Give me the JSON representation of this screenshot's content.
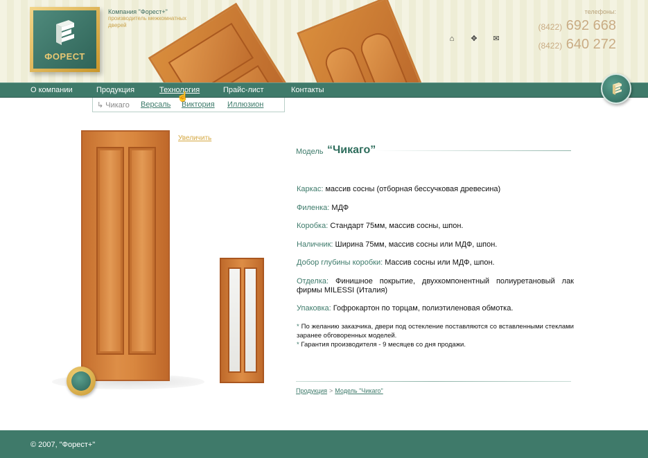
{
  "header": {
    "company_name": "Компания \"Форест+\"",
    "company_tagline": "производитель межкомнатных дверей",
    "logo_text": "ФОРЕСТ",
    "phones_label": "телефоны:",
    "phone1_code": "(8422)",
    "phone1_number": "692 668",
    "phone2_code": "(8422)",
    "phone2_number": "640 272",
    "icons": [
      "home-icon",
      "sitemap-icon",
      "mail-icon"
    ]
  },
  "nav": {
    "items": [
      "О компании",
      "Продукция",
      "Технология",
      "Прайс-лист",
      "Контакты"
    ],
    "active": "Технология"
  },
  "subnav": {
    "current": "↳ Чикаго",
    "items": [
      "Версаль",
      "Виктория",
      "Иллюзион"
    ]
  },
  "product": {
    "zoom_link": "Увеличить",
    "model_label": "Модель",
    "model_name": "“Чикаго”",
    "specs": [
      {
        "label": "Каркас:",
        "value": "массив сосны (отборная бессучковая древесина)"
      },
      {
        "label": "Филенка:",
        "value": "МДФ"
      },
      {
        "label": "Коробка:",
        "value": "Стандарт 75мм, массив сосны, шпон."
      },
      {
        "label": "Наличник:",
        "value": "Ширина 75мм, массив сосны или МДФ, шпон."
      },
      {
        "label": "Добор глубины коробки:",
        "value": "Массив сосны или МДФ, шпон."
      },
      {
        "label": "Отделка:",
        "value": "Финишное покрытие, двухкомпонентный полиуретановый лак фирмы MILESSI (Италия)"
      },
      {
        "label": "Упаковка:",
        "value": "Гофрокартон по торцам, полиэтиленовая обмотка."
      }
    ],
    "notes": [
      "По желанию заказчика, двери под остекление поставляются со вставленными стеклами заранее обговоренных моделей.",
      "Гарантия производителя - 9 месяцев со дня продажи."
    ]
  },
  "breadcrumb": {
    "items": [
      "Продукция",
      "Модель \"Чикаго\""
    ],
    "separator": ">"
  },
  "footer": {
    "copyright": "© 2007, \"Форест+\""
  },
  "colors": {
    "brand_green": "#3f7a6a",
    "accent_gold": "#d5a842",
    "phone_color": "#c9ac84"
  }
}
